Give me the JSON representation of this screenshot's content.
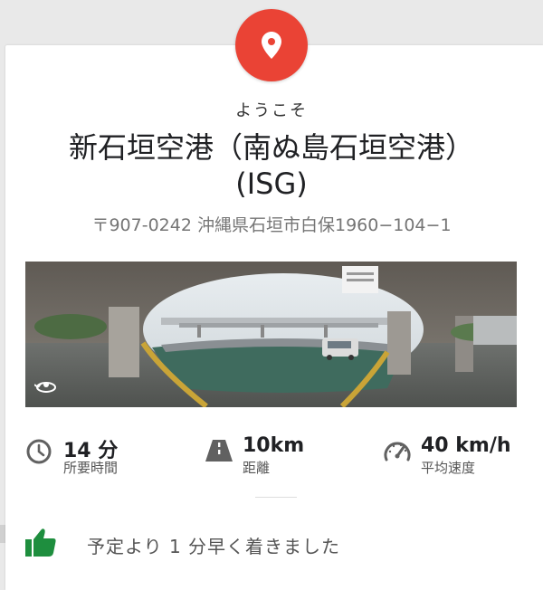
{
  "header": {
    "welcome": "ようこそ",
    "title_line1": "新石垣空港（南ぬ島石垣空港）",
    "title_line2": "(ISG)",
    "address": "〒907-0242 沖縄県石垣市白保1960−104−1"
  },
  "stats": {
    "time": {
      "value": "14 分",
      "label": "所要時間",
      "icon": "clock-icon"
    },
    "distance": {
      "value": "10km",
      "label": "距離",
      "icon": "road-icon"
    },
    "speed": {
      "value": "40 km/h",
      "label": "平均速度",
      "icon": "speedometer-icon"
    }
  },
  "eta": {
    "message": "予定より 1 分早く着きました",
    "icon": "thumbs-up-icon"
  },
  "colors": {
    "pin": "#ea4335",
    "thumb": "#1e8e3e",
    "icon_gray": "#616161"
  }
}
